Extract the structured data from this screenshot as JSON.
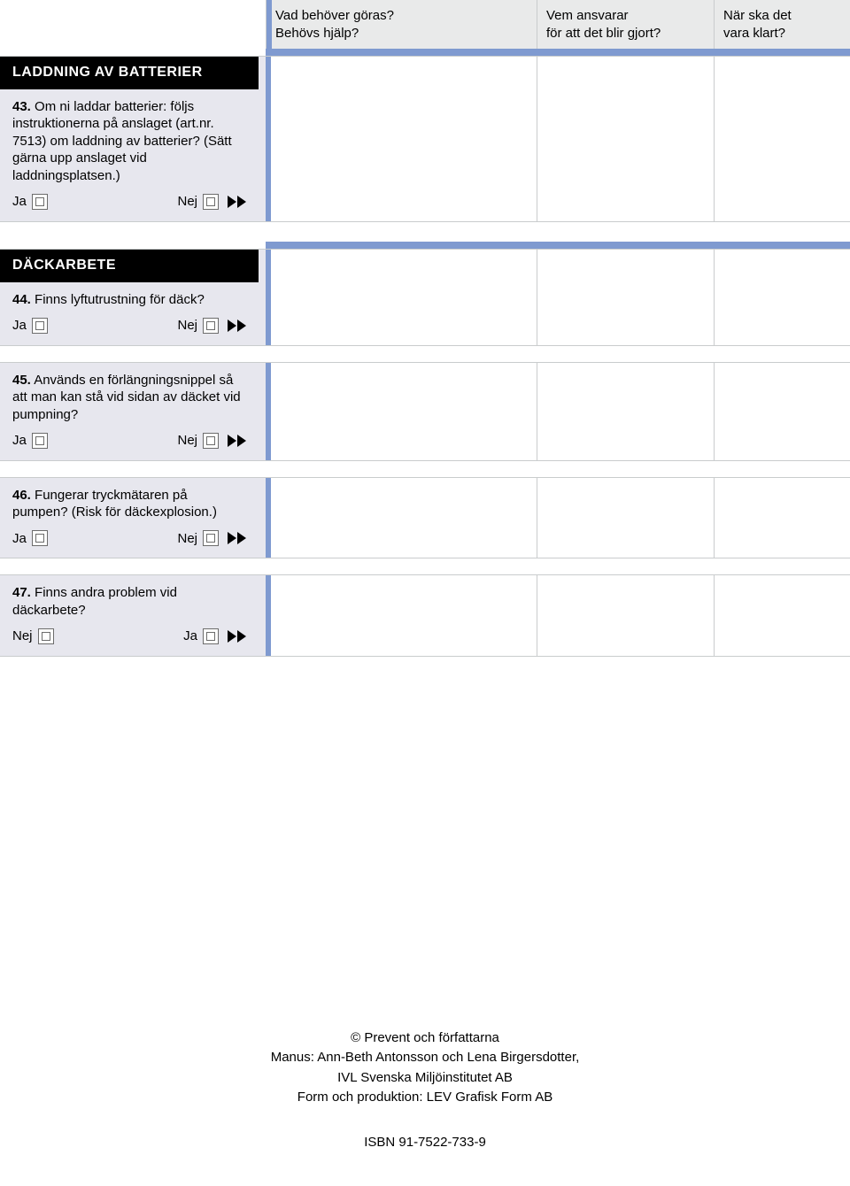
{
  "header": {
    "col1_line1": "Vad behöver göras?",
    "col1_line2": "Behövs hjälp?",
    "col2_line1": "Vem ansvarar",
    "col2_line2": "för att det blir gjort?",
    "col3_line1": "När ska det",
    "col3_line2": "vara klart?"
  },
  "sections": {
    "batteries": {
      "title": "LADDNING AV BATTERIER",
      "q43_num": "43.",
      "q43_text": "Om ni laddar batterier: följs instruktionerna på anslaget (art.nr. 7513) om laddning av batterier? (Sätt gärna upp anslaget vid laddningsplatsen.)",
      "q43_ja": "Ja",
      "q43_nej": "Nej"
    },
    "tires": {
      "title": "DÄCKARBETE",
      "q44_num": "44.",
      "q44_text": "Finns lyftutrustning för däck?",
      "q44_ja": "Ja",
      "q44_nej": "Nej",
      "q45_num": "45.",
      "q45_text": "Används en förlängningsnippel så att man kan stå vid sidan av däcket vid pumpning?",
      "q45_ja": "Ja",
      "q45_nej": "Nej",
      "q46_num": "46.",
      "q46_text": "Fungerar tryckmätaren på pumpen? (Risk för däckexplosion.)",
      "q46_ja": "Ja",
      "q46_nej": "Nej",
      "q47_num": "47.",
      "q47_text": "Finns andra problem vid däckarbete?",
      "q47_nej": "Nej",
      "q47_ja": "Ja"
    }
  },
  "footer": {
    "copyright": "© Prevent och författarna",
    "manus": "Manus: Ann-Beth Antonsson och Lena Birgersdotter,",
    "org": "IVL Svenska Miljöinstitutet AB",
    "form": "Form och produktion: LEV Grafisk Form AB",
    "isbn": "ISBN 91-7522-733-9"
  }
}
